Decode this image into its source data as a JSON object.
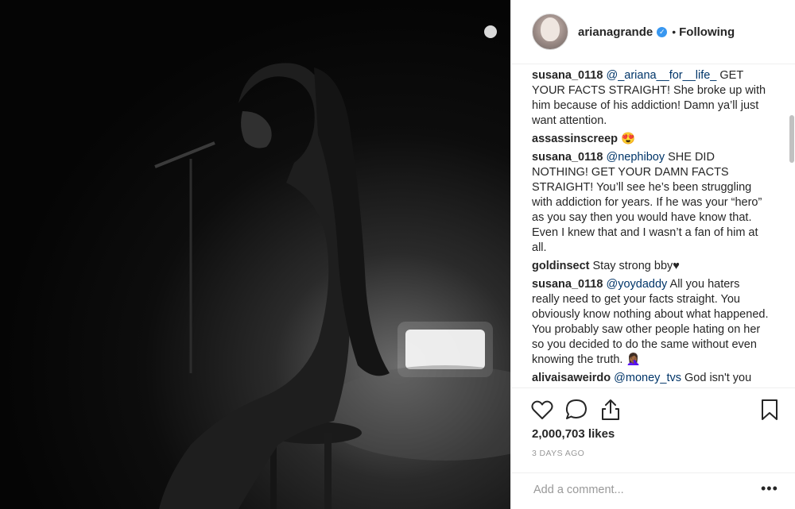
{
  "header": {
    "username": "arianagrande",
    "separator": "•",
    "follow_state": "Following",
    "verified_icon": "verified-badge-icon"
  },
  "comments": [
    {
      "user": "susana_0118",
      "mention": "@_ariana__for__life_",
      "text": "GET YOUR FACTS STRAIGHT! She broke up with him because of his addiction! Damn ya’ll just want attention."
    },
    {
      "user": "assassinscreep",
      "mention": "",
      "text": "😍"
    },
    {
      "user": "susana_0118",
      "mention": "@nephiboy",
      "text": "SHE DID NOTHING! GET YOUR DAMN FACTS STRAIGHT! You’ll see he’s been struggling with addiction for years. If he was your “hero” as you say then you would have know that. Even I knew that and I wasn’t a fan of him at all."
    },
    {
      "user": "goldinsect",
      "mention": "",
      "text": "Stay strong bby♥"
    },
    {
      "user": "susana_0118",
      "mention": "@yoydaddy",
      "text": "All you haters really need to get your facts straight. You obviously know nothing about what happened. You probably saw other people hating on her so you decided to do the same without even knowing the truth. 🤦🏾‍♀️"
    },
    {
      "user": "alivaisaweirdo",
      "mention": "@money_tvs",
      "text": "God isn't you"
    }
  ],
  "actions": {
    "like_icon": "heart-icon",
    "comment_icon": "comment-bubble-icon",
    "share_icon": "share-icon",
    "save_icon": "bookmark-icon"
  },
  "likes": "2,000,703 likes",
  "posted_ago": "3 DAYS AGO",
  "add_comment": {
    "placeholder": "Add a comment...",
    "more_label": "•••"
  }
}
